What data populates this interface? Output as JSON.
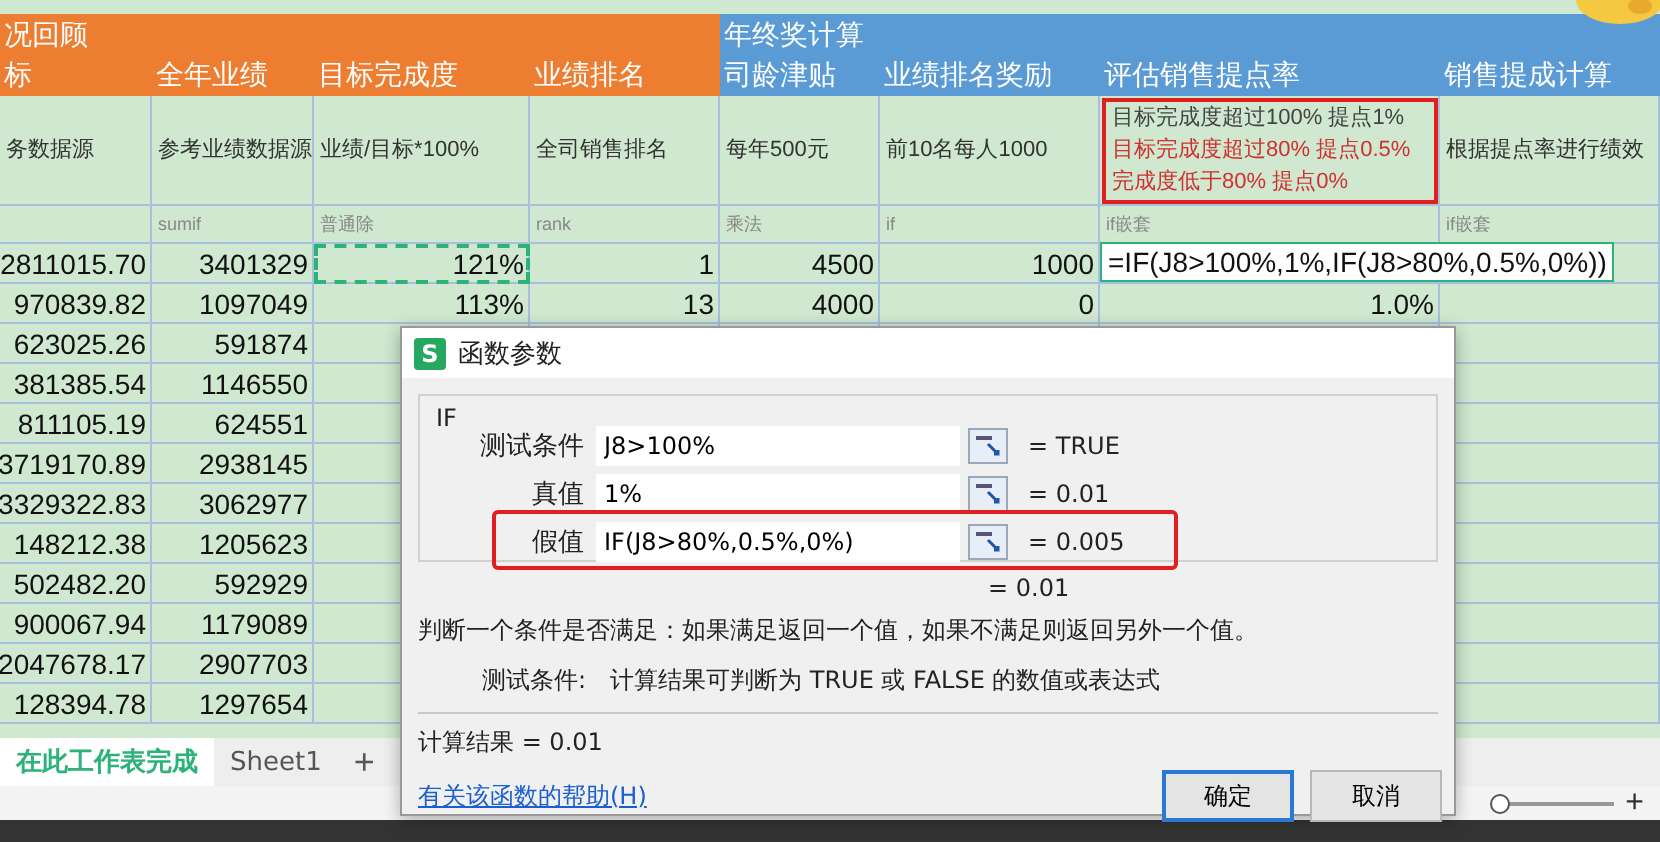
{
  "sheet": {
    "group_headers": [
      {
        "text": "况回顾",
        "kind": "review"
      },
      {
        "text": "年终奖计算",
        "kind": "bonus"
      }
    ],
    "columns": [
      {
        "title": "标",
        "kind": "review",
        "desc_lines": [
          {
            "text": "务数据源",
            "color": "#333333"
          }
        ],
        "highlighted": false
      },
      {
        "title": "全年业绩",
        "kind": "review",
        "desc_lines": [
          {
            "text": "参考业绩数据源",
            "color": "#333333"
          }
        ],
        "hint": "sumif",
        "highlighted": false
      },
      {
        "title": "目标完成度",
        "kind": "review",
        "desc_lines": [
          {
            "text": "业绩/目标*100%",
            "color": "#333333"
          }
        ],
        "hint": "普通除",
        "highlighted": false
      },
      {
        "title": "业绩排名",
        "kind": "review",
        "desc_lines": [
          {
            "text": "全司销售排名",
            "color": "#333333"
          }
        ],
        "hint": "rank",
        "highlighted": false
      },
      {
        "title": "司龄津贴",
        "kind": "bonus",
        "desc_lines": [
          {
            "text": "每年500元",
            "color": "#333333"
          }
        ],
        "hint": "乘法",
        "highlighted": false
      },
      {
        "title": "业绩排名奖励",
        "kind": "bonus",
        "desc_lines": [
          {
            "text": "前10名每人1000",
            "color": "#333333"
          }
        ],
        "hint": "if",
        "highlighted": false
      },
      {
        "title": "评估销售提点率",
        "kind": "bonus",
        "desc_lines": [
          {
            "text": "目标完成度超过100%  提点1%",
            "color": "#444444"
          },
          {
            "text": "目标完成度超过80%   提点0.5%",
            "color": "#d03030"
          },
          {
            "text": "完成度低于80%   提点0%",
            "color": "#d03030"
          }
        ],
        "hint": "if嵌套",
        "highlighted": true
      },
      {
        "title": "销售提成计算",
        "kind": "bonus",
        "desc_lines": [
          {
            "text": "根据提点率进行绩效",
            "color": "#333333"
          }
        ],
        "hint": "if嵌套",
        "highlighted": false
      }
    ],
    "rows": [
      {
        "cells": [
          {
            "text": "2811015.70",
            "marquee": false
          },
          {
            "text": "3401329",
            "marquee": false
          },
          {
            "text": "121%",
            "marquee": true
          },
          {
            "text": "1",
            "marquee": false
          },
          {
            "text": "4500",
            "marquee": false
          },
          {
            "text": "1000",
            "marquee": false
          }
        ],
        "formula": "=IF(J8>100%,1%,IF(J8>80%,0.5%,0%))"
      },
      {
        "cells": [
          {
            "text": "970839.82",
            "marquee": false
          },
          {
            "text": "1097049",
            "marquee": false
          },
          {
            "text": "113%",
            "marquee": false
          },
          {
            "text": "13",
            "marquee": false
          },
          {
            "text": "4000",
            "marquee": false
          },
          {
            "text": "0",
            "marquee": false
          },
          {
            "text": "1.0%",
            "marquee": false
          }
        ]
      },
      {
        "cells": [
          {
            "text": "623025.26",
            "marquee": false
          },
          {
            "text": "591874",
            "marquee": false
          }
        ]
      },
      {
        "cells": [
          {
            "text": "381385.54",
            "marquee": false
          },
          {
            "text": "1146550",
            "marquee": false
          }
        ]
      },
      {
        "cells": [
          {
            "text": "811105.19",
            "marquee": false
          },
          {
            "text": "624551",
            "marquee": false
          }
        ]
      },
      {
        "cells": [
          {
            "text": "3719170.89",
            "marquee": false
          },
          {
            "text": "2938145",
            "marquee": false
          }
        ]
      },
      {
        "cells": [
          {
            "text": "3329322.83",
            "marquee": false
          },
          {
            "text": "3062977",
            "marquee": false
          }
        ]
      },
      {
        "cells": [
          {
            "text": "148212.38",
            "marquee": false
          },
          {
            "text": "1205623",
            "marquee": false
          }
        ]
      },
      {
        "cells": [
          {
            "text": "502482.20",
            "marquee": false
          },
          {
            "text": "592929",
            "marquee": false
          }
        ]
      },
      {
        "cells": [
          {
            "text": "900067.94",
            "marquee": false
          },
          {
            "text": "1179089",
            "marquee": false
          }
        ]
      },
      {
        "cells": [
          {
            "text": "2047678.17",
            "marquee": false
          },
          {
            "text": "2907703",
            "marquee": false
          }
        ]
      },
      {
        "cells": [
          {
            "text": "128394.78",
            "marquee": false
          },
          {
            "text": "1297654",
            "marquee": false
          }
        ]
      }
    ]
  },
  "sheet_tabs": [
    {
      "label": "在此工作表完成",
      "selected": true
    },
    {
      "label": "Sheet1",
      "selected": false
    }
  ],
  "add_sheet": "+",
  "status_bar": {
    "zoom_slider": {
      "level": 0.05
    },
    "zoom_in": "+"
  },
  "dialog": {
    "app_icon_letter": "S",
    "title": "函数参数",
    "function_name": "IF",
    "arguments": [
      {
        "label": "测试条件",
        "value": "J8>100%",
        "result": "= TRUE",
        "highlighted": false
      },
      {
        "label": "真值",
        "value": "1%",
        "result": "= 0.01",
        "highlighted": false
      },
      {
        "label": "假值",
        "value": "IF(J8>80%,0.5%,0%)",
        "result": "= 0.005",
        "highlighted": true
      }
    ],
    "function_result": "= 0.01",
    "description": "判断一个条件是否满足：如果满足返回一个值，如果不满足则返回另外一个值。",
    "argument_help_label": "测试条件:",
    "argument_help": "计算结果可判断为 TRUE 或 FALSE 的数值或表达式",
    "calc_result": "计算结果  =  0.01",
    "help_link": "有关该函数的帮助(H)",
    "buttons": [
      {
        "label": "确定",
        "default": true
      },
      {
        "label": "取消",
        "default": false
      }
    ]
  }
}
